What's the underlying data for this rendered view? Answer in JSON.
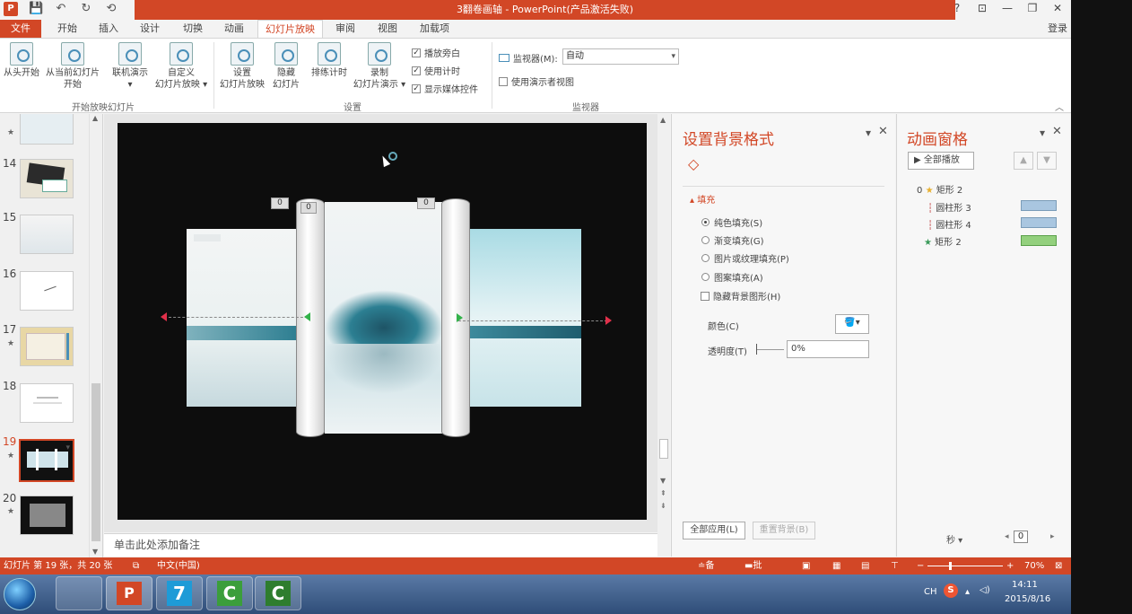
{
  "window": {
    "title": "3翻卷画轴 - PowerPoint(产品激活失败)",
    "controls": [
      "?",
      "⊡",
      "—",
      "❐",
      "✕"
    ]
  },
  "quick_access": [
    "P",
    "💾",
    "↶",
    "↻",
    "⟲"
  ],
  "tabs": [
    "文件",
    "开始",
    "插入",
    "设计",
    "切换",
    "动画",
    "幻灯片放映",
    "审阅",
    "视图",
    "加载项"
  ],
  "login": "登录",
  "ribbon": {
    "buttons": [
      {
        "label": "从头开始",
        "label2": ""
      },
      {
        "label": "从当前幻灯片",
        "label2": "开始"
      },
      {
        "label": "联机演示",
        "label2": "▾"
      },
      {
        "label": "自定义",
        "label2": "幻灯片放映 ▾"
      },
      {
        "label": "设置",
        "label2": "幻灯片放映"
      },
      {
        "label": "隐藏",
        "label2": "幻灯片"
      },
      {
        "label": "排练计时",
        "label2": ""
      },
      {
        "label": "录制",
        "label2": "幻灯片演示 ▾"
      }
    ],
    "groups": [
      "开始放映幻灯片",
      "设置",
      "监视器"
    ],
    "checkboxes": [
      "播放旁白",
      "使用计时",
      "显示媒体控件"
    ],
    "monitor_label": "监视器(M):",
    "monitor_value": "自动",
    "presenter_view": "使用演示者视图"
  },
  "thumbnails": [
    {
      "num": "",
      "star": "★"
    },
    {
      "num": "14",
      "star": ""
    },
    {
      "num": "15",
      "star": ""
    },
    {
      "num": "16",
      "star": ""
    },
    {
      "num": "17",
      "star": "★"
    },
    {
      "num": "18",
      "star": ""
    },
    {
      "num": "19",
      "star": "★"
    },
    {
      "num": "20",
      "star": "★"
    }
  ],
  "slide": {
    "anim_tags": [
      "0",
      "0",
      "0"
    ]
  },
  "notes_placeholder": "单击此处添加备注",
  "format_pane": {
    "title": "设置背景格式",
    "section": "填充",
    "options": [
      "纯色填充(S)",
      "渐变填充(G)",
      "图片或纹理填充(P)",
      "图案填充(A)"
    ],
    "hide_bg": "隐藏背景图形(H)",
    "color_label": "颜色(C)",
    "transparency_label": "透明度(T)",
    "transparency_value": "0%",
    "apply_all": "全部应用(L)",
    "reset": "重置背景(B)"
  },
  "anim_pane": {
    "title": "动画窗格",
    "play_all": "全部播放",
    "items": [
      {
        "order": "0",
        "name": "矩形 2",
        "color": ""
      },
      {
        "order": "",
        "name": "圆柱形 3",
        "color": "#a9c6e0"
      },
      {
        "order": "",
        "name": "圆柱形 4",
        "color": "#a9c6e0"
      },
      {
        "order": "",
        "name": "矩形 2",
        "color": "#93d07d"
      }
    ],
    "seconds": "秒 ▾",
    "page_value": "0"
  },
  "status": {
    "slide_info": "幻灯片 第 19 张，共 20 张",
    "language": "中文(中国)",
    "notes": "备注",
    "comments": "批注",
    "zoom": "70%"
  },
  "tray": {
    "lang": "CH",
    "time": "14:11",
    "date": "2015/8/16"
  },
  "taskbar_apps": [
    "",
    "",
    "P",
    "7",
    "C",
    "C"
  ],
  "colors": {
    "accent": "#d24726",
    "slide_bg": "#0d0d0d"
  }
}
